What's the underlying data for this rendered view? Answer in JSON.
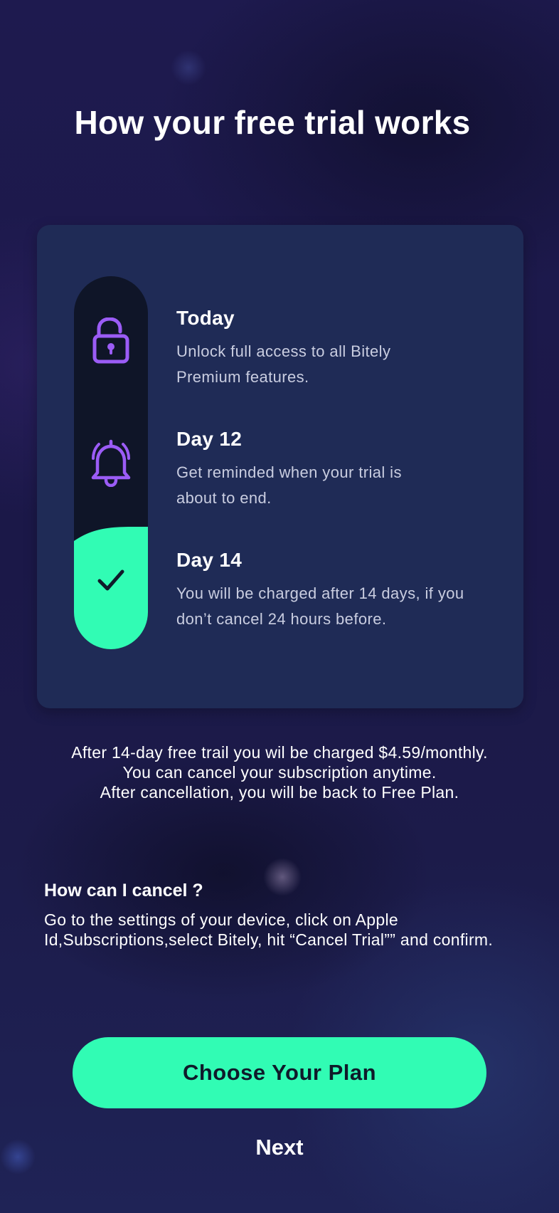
{
  "title": "How your free trial works",
  "timeline": [
    {
      "label": "Today",
      "description": "Unlock full access to all Bitely Premium features.",
      "icon": "lock-open-icon"
    },
    {
      "label": "Day 12",
      "description": "Get reminded when your trial is about to end.",
      "icon": "bell-icon"
    },
    {
      "label": "Day 14",
      "description": "You will be charged after 14 days, if you don’t cancel 24 hours before.",
      "icon": "check-icon"
    }
  ],
  "info": {
    "line1": "After 14-day free trail you wil be charged $4.59/monthly.",
    "line2": "You can cancel your subscription anytime.",
    "line3": "After cancellation, you will be back to Free Plan."
  },
  "faq": {
    "question": "How can I cancel ?",
    "answer": "Go to the settings of your device, click on Apple Id,Subscriptions,select Bitely, hit “Cancel Trial”” and confirm."
  },
  "cta_label": "Choose Your Plan",
  "next_label": "Next",
  "colors": {
    "accent": "#31fcb4",
    "icon_purple": "#9b5cf6",
    "card": "#1f2b56",
    "track": "#0f1528",
    "background": "#1e1a4f"
  }
}
